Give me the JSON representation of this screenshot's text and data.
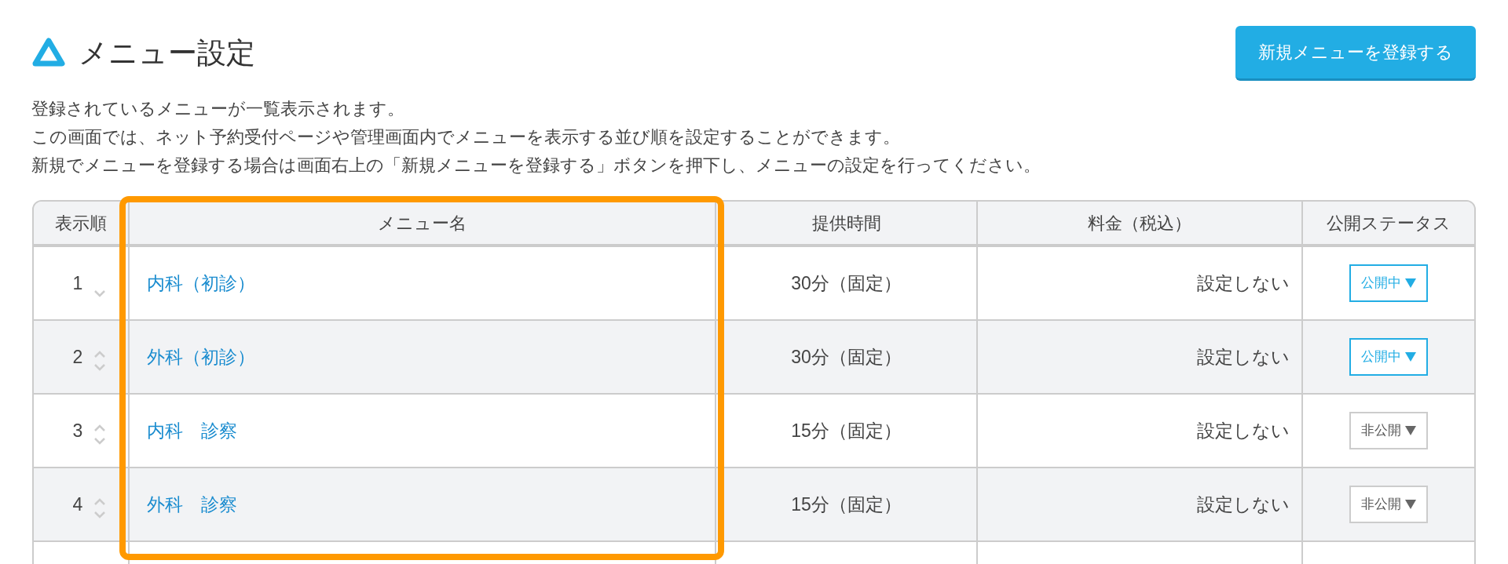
{
  "page": {
    "title": "メニュー設定",
    "new_button": "新規メニューを登録する"
  },
  "description": [
    "登録されているメニューが一覧表示されます。",
    "この画面では、ネット予約受付ページや管理画面内でメニューを表示する並び順を設定することができます。",
    "新規でメニューを登録する場合は画面右上の「新規メニューを登録する」ボタンを押下し、メニューの設定を行ってください。"
  ],
  "table": {
    "columns": [
      "表示順",
      "メニュー名",
      "提供時間",
      "料金（税込）",
      "公開ステータス"
    ],
    "rows": [
      {
        "order": "1",
        "can_move_up": false,
        "can_move_down": true,
        "name": "内科（初診）",
        "duration": "30分（固定）",
        "price": "設定しない",
        "status": "公開中",
        "published": true
      },
      {
        "order": "2",
        "can_move_up": true,
        "can_move_down": true,
        "name": "外科（初診）",
        "duration": "30分（固定）",
        "price": "設定しない",
        "status": "公開中",
        "published": true
      },
      {
        "order": "3",
        "can_move_up": true,
        "can_move_down": true,
        "name": "内科　診察",
        "duration": "15分（固定）",
        "price": "設定しない",
        "status": "非公開",
        "published": false
      },
      {
        "order": "4",
        "can_move_up": true,
        "can_move_down": true,
        "name": "外科　診察",
        "duration": "15分（固定）",
        "price": "設定しない",
        "status": "非公開",
        "published": false
      }
    ]
  },
  "highlight": {
    "on": true
  }
}
